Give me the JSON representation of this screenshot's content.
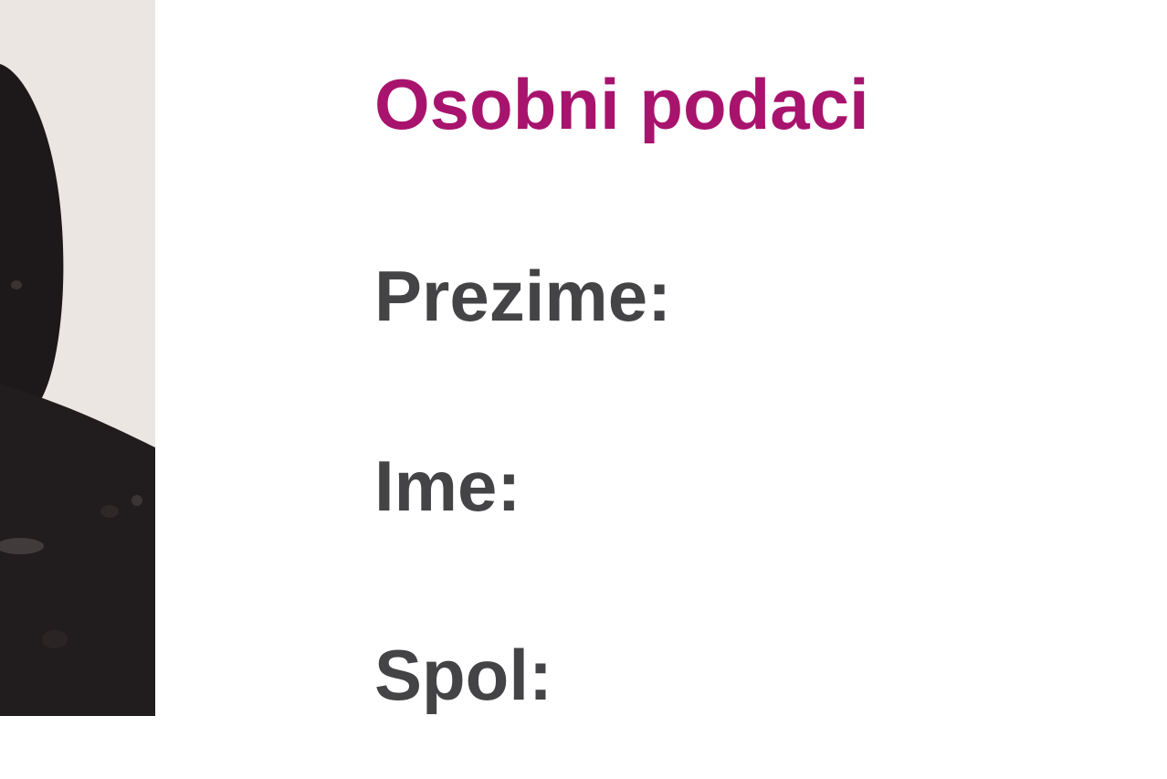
{
  "section": {
    "title": "Osobni podaci"
  },
  "fields": [
    {
      "label": "Prezime:"
    },
    {
      "label": "Ime:"
    },
    {
      "label": "Spol:"
    }
  ],
  "colors": {
    "title": "#a8136d",
    "label": "#444446",
    "background": "#ffffff"
  }
}
